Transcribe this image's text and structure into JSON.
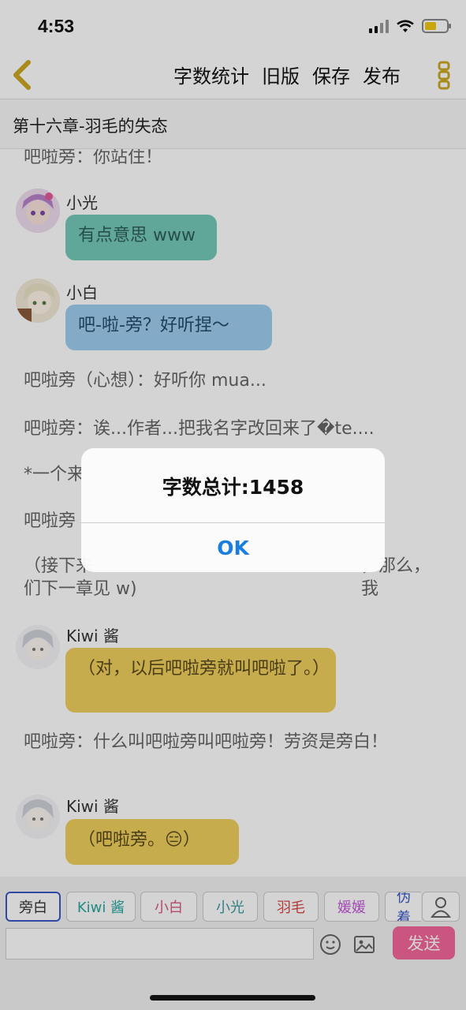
{
  "status": {
    "time": "4:53"
  },
  "nav": {
    "actions": [
      "字数统计",
      "旧版",
      "保存",
      "发布"
    ]
  },
  "chapter": {
    "title": "第十六章-羽毛的失态"
  },
  "chat": {
    "top_partial": "吧啦旁：你站住！",
    "speaker_1": "小光",
    "bubble_1": "有点意思 www",
    "speaker_2": "小白",
    "bubble_2": "吧-啦-旁？好听捏～",
    "narration_1": "吧啦旁（心想）：好听你 mua...",
    "narration_2": "吧啦旁：诶...作者...把我名字改回来了�te....",
    "narration_3": "*一个来",
    "narration_4": "吧啦旁",
    "narration_5": "（接下来",
    "narration_5b": "，那么，我",
    "narration_5c": "们下一章见 w)",
    "speaker_3": "Kiwi 酱",
    "bubble_3": "（对，以后吧啦旁就叫吧啦了。）",
    "narration_6": "吧啦旁：什么叫吧啦旁叫吧啦旁！劳资是旁白！",
    "speaker_4": "Kiwi 酱",
    "bubble_4": "（吧啦旁。😑）"
  },
  "roles": [
    "旁白",
    "Kiwi 酱",
    "小白",
    "小光",
    "羽毛",
    "媛媛",
    "伪着"
  ],
  "input": {
    "placeholder": ""
  },
  "send_label": "发送",
  "alert": {
    "title": "字数总计:1458",
    "ok": "OK"
  },
  "colors": {
    "bubble_teal": "#74c8b8",
    "bubble_blue": "#9ecdee",
    "bubble_yellow": "#f0cf5e",
    "send": "#f2679a",
    "alert_button": "#1a7de0"
  }
}
